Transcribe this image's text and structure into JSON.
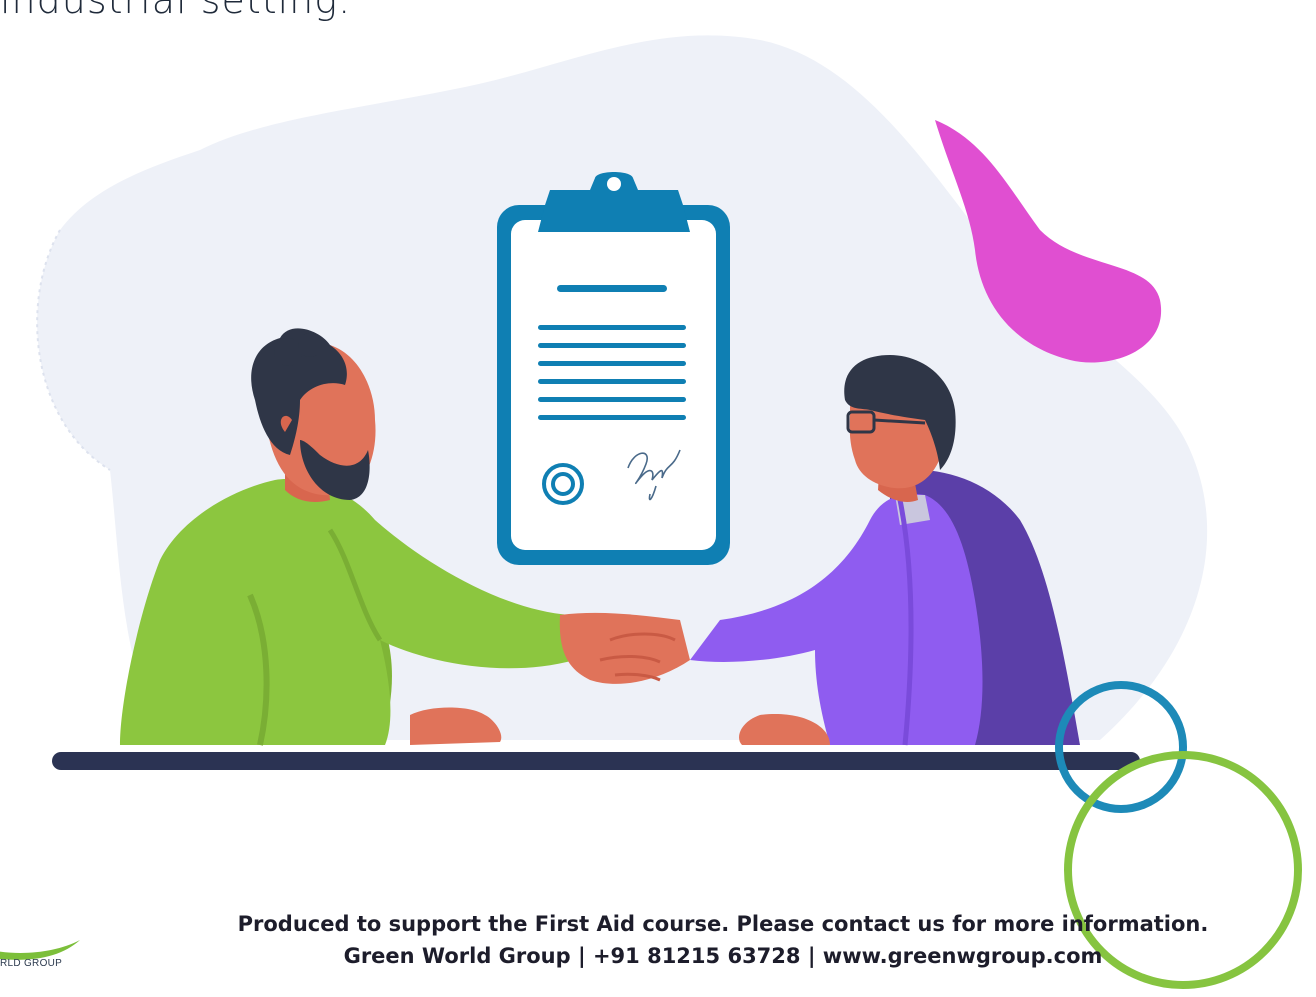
{
  "heading": {
    "text": "industrial setting."
  },
  "footer": {
    "line1": "Produced to support the First Aid course. Please contact us for more information.",
    "line2": "Green World Group | +91 81215  63728 | www.greenwgroup.com"
  },
  "logo": {
    "text": "RLD GROUP"
  },
  "illustration": {
    "icons": [
      "clipboard-icon",
      "seal-icon",
      "signature-icon",
      "handshake-icon"
    ],
    "colors": {
      "background_blob": "#eef1f8",
      "pink_blob": "#e04fd1",
      "clipboard_blue": "#0f7fb3",
      "green_shirt": "#8cc63f",
      "purple_shirt": "#8f5cf0",
      "vest": "#5b3fa8",
      "hair": "#2f3647",
      "skin": "#e0735a",
      "desk": "#2b3353",
      "ring_blue": "#1d8ab8",
      "ring_green": "#86c440"
    }
  }
}
